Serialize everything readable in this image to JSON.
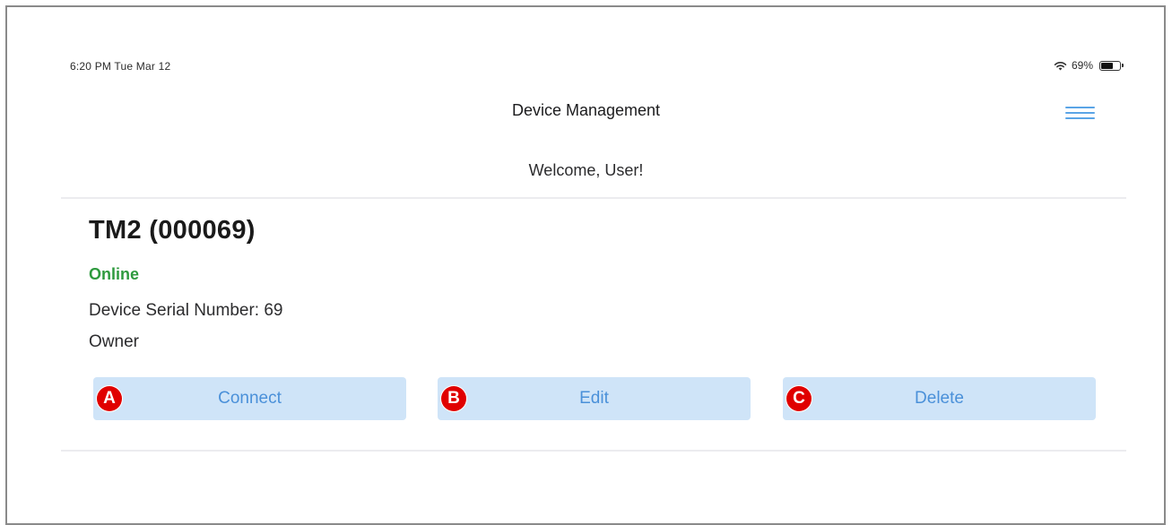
{
  "status_bar": {
    "time_date": "6:20 PM   Tue Mar 12",
    "wifi_icon": "wifi-icon",
    "battery_percent": "69%",
    "battery_level": 0.69
  },
  "nav": {
    "title": "Device Management",
    "menu_icon": "hamburger-menu-icon"
  },
  "welcome": "Welcome, User!",
  "device": {
    "name": "TM2 (000069)",
    "status": "Online",
    "serial": "Device Serial Number: 69",
    "owner": "Owner"
  },
  "actions": {
    "connect": {
      "label": "Connect",
      "marker": "A"
    },
    "edit": {
      "label": "Edit",
      "marker": "B"
    },
    "delete": {
      "label": "Delete",
      "marker": "C"
    }
  },
  "colors": {
    "accent": "#4a90d9",
    "button_bg": "#cfe4f8",
    "online": "#2e9a3e",
    "marker": "#e00000"
  }
}
